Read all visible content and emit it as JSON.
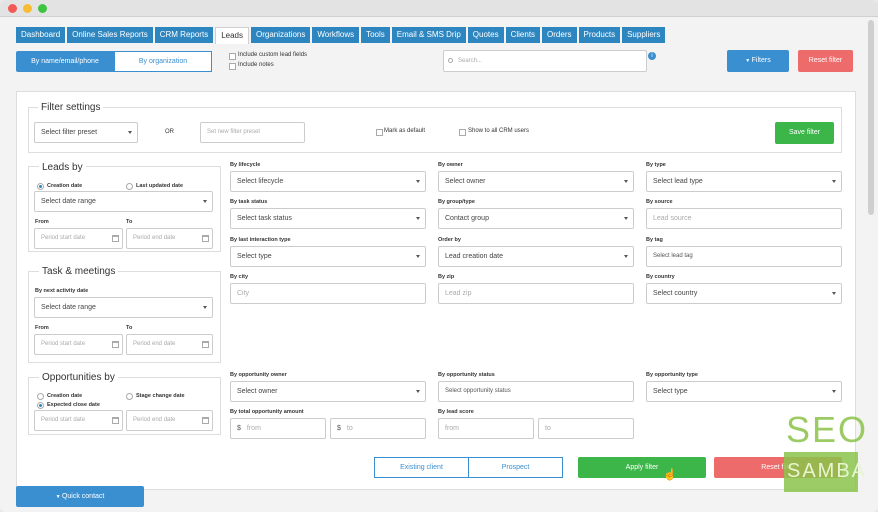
{
  "nav": {
    "tabs": [
      "Dashboard",
      "Online Sales Reports",
      "CRM Reports",
      "Leads",
      "Organizations",
      "Workflows",
      "Tools",
      "Email & SMS Drip",
      "Quotes",
      "Clients",
      "Orders",
      "Products",
      "Suppliers"
    ],
    "active": "Leads"
  },
  "toolbar": {
    "by_name": "By name/email/phone",
    "by_org": "By organization",
    "include_custom": "Include custom lead fields",
    "include_notes": "Include notes",
    "search_placeholder": "Search...",
    "filters": "Filters",
    "reset_filter": "Reset filter"
  },
  "filter_settings": {
    "title": "Filter settings",
    "preset": "Select filter preset",
    "or": "OR",
    "new_preset": "Set new filter preset",
    "mark_default": "Mark as default",
    "show_all": "Show to all CRM users",
    "save": "Save filter"
  },
  "leads_by": {
    "title": "Leads by",
    "creation_date": "Creation date",
    "last_updated": "Last updated date",
    "date_range": "Select date range",
    "from": "From",
    "to": "To",
    "start": "Period start date",
    "end": "Period end date"
  },
  "task": {
    "title": "Task & meetings",
    "next_activity": "By next activity date",
    "date_range": "Select date range",
    "from": "From",
    "to": "To",
    "start": "Period start date",
    "end": "Period end date"
  },
  "opps": {
    "title": "Opportunities by",
    "creation_date": "Creation date",
    "stage_change": "Stage change date",
    "expected_close": "Expected close date",
    "start": "Period start date",
    "end": "Period end date"
  },
  "grid": {
    "lifecycle_l": "By lifecycle",
    "lifecycle_v": "Select lifecycle",
    "owner_l": "By owner",
    "owner_v": "Select owner",
    "type_l": "By type",
    "type_v": "Select lead type",
    "task_l": "By task status",
    "task_v": "Select task status",
    "group_l": "By group/type",
    "group_v": "Contact group",
    "source_l": "By source",
    "source_v": "Lead source",
    "interaction_l": "By last interaction type",
    "interaction_v": "Select type",
    "order_l": "Order by",
    "order_v": "Lead creation date",
    "tag_l": "By tag",
    "tag_v": "Select lead tag",
    "city_l": "By city",
    "city_v": "City",
    "zip_l": "By zip",
    "zip_v": "Lead zip",
    "country_l": "By country",
    "country_v": "Select country",
    "opp_owner_l": "By opportunity owner",
    "opp_owner_v": "Select owner",
    "opp_status_l": "By opportunity status",
    "opp_status_v": "Select opportunity status",
    "opp_type_l": "By opportunity type",
    "opp_type_v": "Select type",
    "amount_l": "By total opportunity amount",
    "currency": "$",
    "amount_from": "from",
    "amount_to": "to",
    "score_l": "By lead score",
    "score_from": "from",
    "score_to": "to"
  },
  "footer": {
    "existing": "Existing client",
    "prospect": "Prospect",
    "apply": "Apply filter",
    "reset": "Reset filter",
    "quick_contact": "Quick contact"
  },
  "watermark": {
    "line1": "SEO",
    "line2": "SAMBA"
  },
  "colors": {
    "accent": "#2e86c1",
    "green": "#3cb549",
    "red": "#ee6b6b"
  }
}
